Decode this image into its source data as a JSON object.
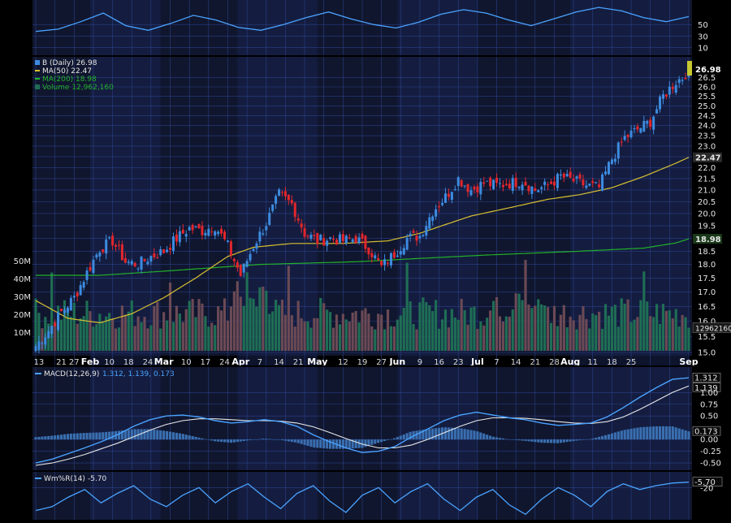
{
  "colors": {
    "background": "#000000",
    "panel": "#10162e",
    "panel_shade": "#182450",
    "grid": "#2b3f86",
    "up_candle": "#3d8be0",
    "down_candle": "#e3262c",
    "ma50": "#d8c030",
    "ma200": "#22b12a",
    "volume_up": "#1f6e55",
    "volume_down": "#6b4a55",
    "macd": "#4aa3ff",
    "signal": "#e8e8e8",
    "histogram": "#3a6fb0",
    "williams": "#4aa3ff",
    "last_price_box": "#c8c832"
  },
  "legend": {
    "price": "B (Daily) 26.98",
    "ma50": "MA(50) 22.47",
    "ma200": "MA(200) 18.98",
    "volume": "Volume 12,962,160",
    "macd_name": "MACD(12,26,9)",
    "macd_values": "1.312, 1.139, 0.173",
    "williams_name": "Wm%R(14)",
    "williams_value": "-5.70"
  },
  "chart_data": [
    {
      "type": "line",
      "panel": "top indicator (partially visible)",
      "y_ticks": [
        "50",
        "30",
        "10"
      ],
      "series": [
        {
          "values": [
            38,
            42,
            55,
            70,
            48,
            40,
            52,
            66,
            58,
            45,
            40,
            50,
            62,
            72,
            60,
            50,
            44,
            54,
            68,
            76,
            70,
            58,
            48,
            60,
            72,
            80,
            74,
            62,
            55,
            64
          ]
        }
      ]
    },
    {
      "type": "candlestick",
      "panel": "price",
      "x_tick_labels": [
        "13",
        "21",
        "27",
        "Feb",
        "10",
        "18",
        "24",
        "Mar",
        "10",
        "17",
        "24",
        "Apr",
        "7",
        "14",
        "21",
        "May",
        "12",
        "19",
        "27",
        "Jun",
        "9",
        "16",
        "23",
        "Jul",
        "7",
        "14",
        "21",
        "28",
        "Aug",
        "11",
        "18",
        "25",
        "Sep"
      ],
      "y_ticks": [
        "26.5",
        "26.0",
        "25.5",
        "25.0",
        "24.5",
        "24.0",
        "23.5",
        "23.0",
        "22.5",
        "22.0",
        "21.5",
        "21.0",
        "20.5",
        "20.0",
        "19.5",
        "19.0",
        "18.5",
        "18.0",
        "17.5",
        "17.0",
        "16.5",
        "16.0",
        "15.5",
        "15.0"
      ],
      "y_axis": "log",
      "ylim": [
        15.0,
        27.3
      ],
      "last_price": "26.98",
      "ma50_last": "22.47",
      "ma200_last": "18.98",
      "volume_last": "12962160",
      "volume_ticks": [
        "50M",
        "40M",
        "30M",
        "20M",
        "10M"
      ],
      "close_anchors": [
        [
          0,
          15.2
        ],
        [
          4,
          15.7
        ],
        [
          8,
          16.3
        ],
        [
          12,
          16.8
        ],
        [
          16,
          17.7
        ],
        [
          20,
          18.6
        ],
        [
          24,
          18.9
        ],
        [
          28,
          18.1
        ],
        [
          32,
          18.0
        ],
        [
          36,
          18.3
        ],
        [
          40,
          18.5
        ],
        [
          44,
          19.0
        ],
        [
          48,
          19.4
        ],
        [
          52,
          19.3
        ],
        [
          56,
          19.5
        ],
        [
          60,
          18.7
        ],
        [
          64,
          17.6
        ],
        [
          68,
          18.7
        ],
        [
          72,
          19.6
        ],
        [
          76,
          20.8
        ],
        [
          80,
          20.4
        ],
        [
          84,
          19.2
        ],
        [
          88,
          18.9
        ],
        [
          92,
          19.0
        ],
        [
          96,
          18.9
        ],
        [
          100,
          19.0
        ],
        [
          104,
          18.6
        ],
        [
          108,
          17.9
        ],
        [
          112,
          18.4
        ],
        [
          116,
          19.0
        ],
        [
          120,
          19.1
        ],
        [
          124,
          20.1
        ],
        [
          128,
          20.7
        ],
        [
          132,
          21.5
        ],
        [
          136,
          21.0
        ],
        [
          140,
          21.3
        ],
        [
          144,
          21.2
        ],
        [
          148,
          21.3
        ],
        [
          152,
          21.4
        ],
        [
          156,
          21.0
        ],
        [
          160,
          21.2
        ],
        [
          164,
          21.6
        ],
        [
          168,
          21.4
        ],
        [
          172,
          21.2
        ],
        [
          176,
          21.1
        ],
        [
          180,
          22.4
        ],
        [
          184,
          23.4
        ],
        [
          188,
          23.8
        ],
        [
          192,
          24.2
        ],
        [
          196,
          25.5
        ],
        [
          200,
          26.3
        ],
        [
          202,
          26.5
        ],
        [
          204,
          26.98
        ]
      ],
      "ma50_anchors": [
        [
          0,
          16.7
        ],
        [
          10,
          16.1
        ],
        [
          20,
          15.95
        ],
        [
          30,
          16.25
        ],
        [
          40,
          16.8
        ],
        [
          50,
          17.5
        ],
        [
          60,
          18.3
        ],
        [
          68,
          18.65
        ],
        [
          80,
          18.8
        ],
        [
          96,
          18.8
        ],
        [
          110,
          18.9
        ],
        [
          120,
          19.2
        ],
        [
          136,
          19.9
        ],
        [
          150,
          20.3
        ],
        [
          160,
          20.6
        ],
        [
          170,
          20.8
        ],
        [
          180,
          21.1
        ],
        [
          190,
          21.6
        ],
        [
          200,
          22.2
        ],
        [
          204,
          22.47
        ]
      ],
      "ma200_anchors": [
        [
          0,
          17.6
        ],
        [
          20,
          17.6
        ],
        [
          40,
          17.75
        ],
        [
          70,
          18.0
        ],
        [
          100,
          18.1
        ],
        [
          140,
          18.35
        ],
        [
          170,
          18.5
        ],
        [
          190,
          18.62
        ],
        [
          200,
          18.82
        ],
        [
          204,
          18.98
        ]
      ]
    },
    {
      "type": "line",
      "panel": "MACD(12,26,9)",
      "y_ticks": [
        "1.312",
        "1.139",
        "1.00",
        "0.75",
        "0.50",
        "0.173",
        "0.00",
        "-0.25",
        "-0.50"
      ],
      "ylim": [
        -0.62,
        1.42
      ],
      "series": [
        {
          "name": "MACD",
          "values": [
            -0.5,
            -0.42,
            -0.3,
            -0.18,
            -0.05,
            0.1,
            0.28,
            0.42,
            0.5,
            0.52,
            0.48,
            0.4,
            0.35,
            0.38,
            0.42,
            0.38,
            0.28,
            0.1,
            -0.05,
            -0.18,
            -0.28,
            -0.25,
            -0.15,
            0.05,
            0.22,
            0.4,
            0.52,
            0.58,
            0.52,
            0.46,
            0.42,
            0.35,
            0.3,
            0.32,
            0.35,
            0.48,
            0.68,
            0.9,
            1.1,
            1.28,
            1.312
          ]
        },
        {
          "name": "Signal",
          "values": [
            -0.55,
            -0.5,
            -0.42,
            -0.32,
            -0.2,
            -0.08,
            0.06,
            0.2,
            0.32,
            0.4,
            0.44,
            0.44,
            0.42,
            0.4,
            0.4,
            0.39,
            0.35,
            0.27,
            0.15,
            0.02,
            -0.1,
            -0.18,
            -0.18,
            -0.12,
            0.0,
            0.14,
            0.28,
            0.4,
            0.46,
            0.46,
            0.45,
            0.42,
            0.38,
            0.35,
            0.34,
            0.38,
            0.48,
            0.64,
            0.82,
            1.0,
            1.139
          ]
        },
        {
          "name": "Histogram",
          "last": 0.173
        }
      ]
    },
    {
      "type": "line",
      "panel": "Wm%R(14)",
      "y_ticks": [
        "-5.70",
        "-20"
      ],
      "ylim": [
        -100,
        0
      ],
      "series": [
        {
          "name": "Wm%R(14)",
          "values": [
            -80,
            -70,
            -45,
            -25,
            -60,
            -35,
            -15,
            -50,
            -70,
            -40,
            -20,
            -60,
            -30,
            -10,
            -45,
            -75,
            -35,
            -15,
            -55,
            -85,
            -40,
            -20,
            -60,
            -30,
            -10,
            -50,
            -80,
            -45,
            -25,
            -65,
            -90,
            -50,
            -20,
            -40,
            -70,
            -30,
            -10,
            -25,
            -15,
            -8,
            -5.7
          ]
        }
      ]
    }
  ]
}
